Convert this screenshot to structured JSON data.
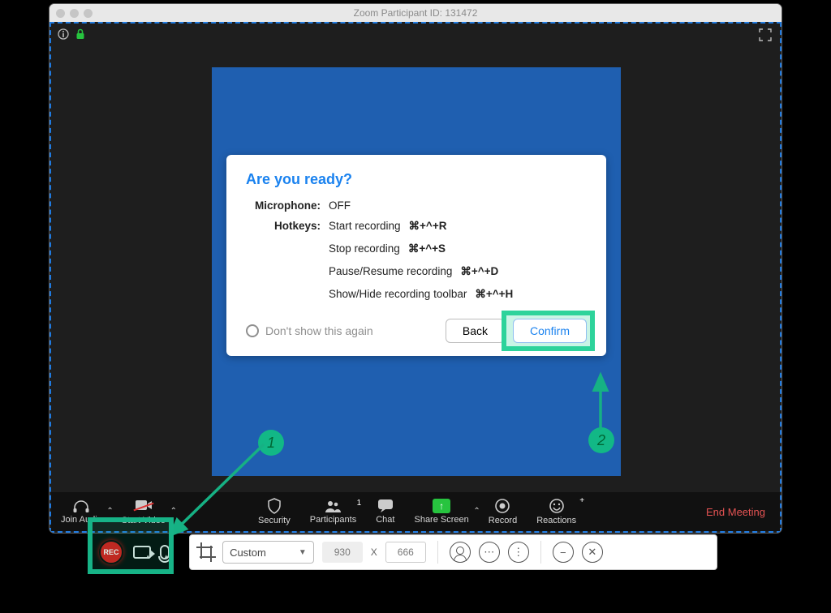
{
  "window": {
    "title": "Zoom Participant ID: 131472"
  },
  "dialog": {
    "title": "Are you ready?",
    "mic_label": "Microphone:",
    "mic_value": "OFF",
    "hotkeys_label": "Hotkeys:",
    "hotkeys": [
      {
        "desc": "Start recording",
        "keys": "⌘+^+R"
      },
      {
        "desc": "Stop recording",
        "keys": "⌘+^+S"
      },
      {
        "desc": "Pause/Resume recording",
        "keys": "⌘+^+D"
      },
      {
        "desc": "Show/Hide recording toolbar",
        "keys": "⌘+^+H"
      }
    ],
    "dont_show": "Don't show this again",
    "back": "Back",
    "confirm": "Confirm"
  },
  "zoom_toolbar": {
    "join_audio": "Join Audio",
    "start_video": "Start Video",
    "security": "Security",
    "participants": "Participants",
    "participants_count": "1",
    "chat": "Chat",
    "share_screen": "Share Screen",
    "record": "Record",
    "reactions": "Reactions",
    "end": "End Meeting"
  },
  "callouts": {
    "one": "1",
    "two": "2"
  },
  "rec_bar": {
    "rec": "REC",
    "preset": "Custom",
    "width": "930",
    "sep": "X",
    "height": "666",
    "dots": "⋯",
    "minus": "−",
    "close": "✕",
    "chat": "⋯"
  }
}
